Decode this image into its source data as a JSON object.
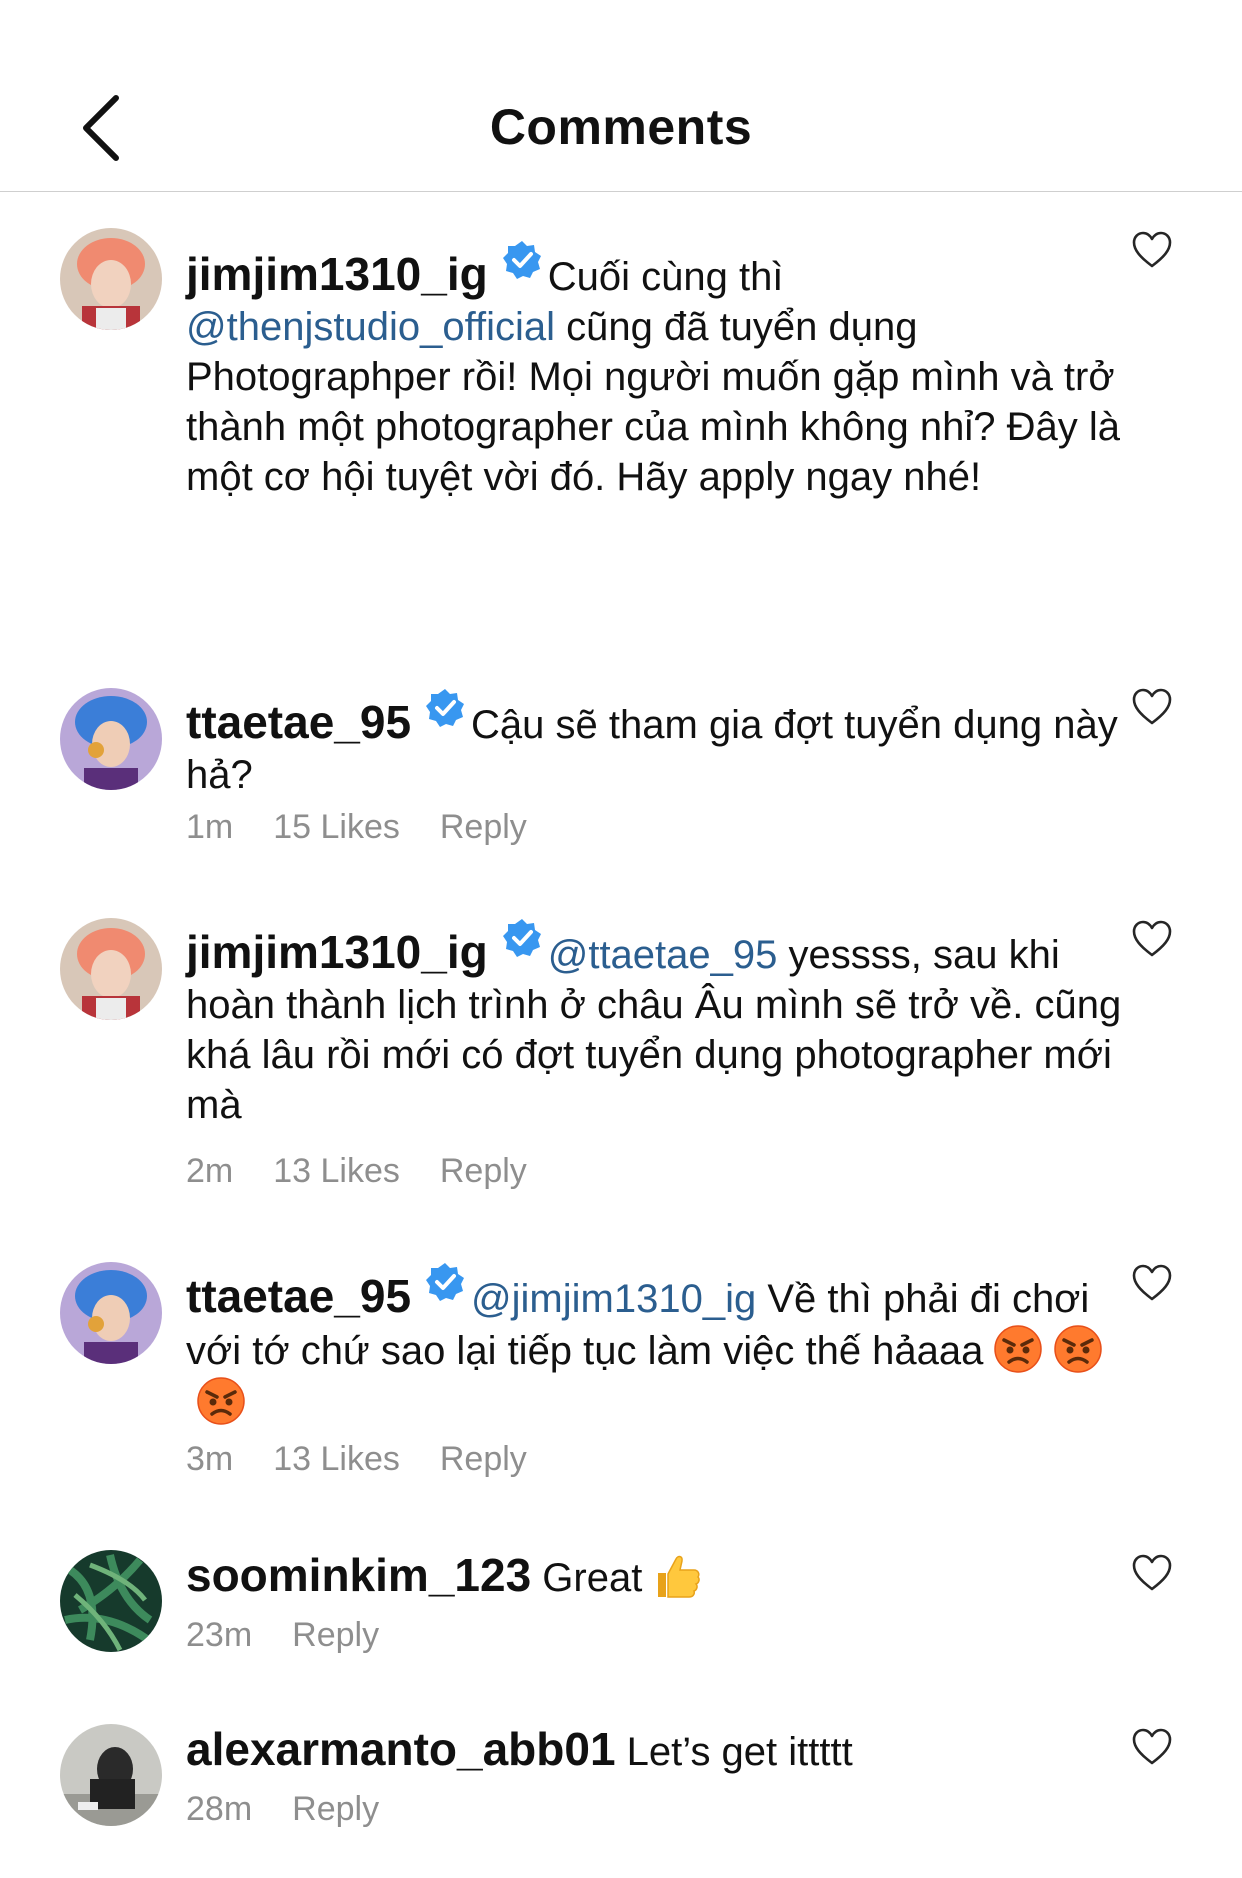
{
  "header": {
    "title": "Comments"
  },
  "comments": [
    {
      "username": "jimjim1310_ig",
      "text_before": "Cuối cùng thì",
      "mention": "@thenjstudio_official",
      "text_after": "cũng đã tuyển dụng Photographper rồi! Mọi người muốn gặp mình và trở thành một photographer của mình không nhỉ? Đây là một cơ hội tuyệt vời đó. Hãy apply ngay nhé!"
    },
    {
      "username": "ttaetae_95",
      "text": "Cậu sẽ tham gia đợt tuyển dụng này hả?",
      "time": "1m",
      "likes": "15 Likes",
      "reply": "Reply"
    },
    {
      "username": "jimjim1310_ig",
      "mention": "@ttaetae_95",
      "text": "yessss, sau khi hoàn thành lịch trình ở châu Âu mình sẽ trở về. cũng khá lâu rồi mới có đợt tuyển dụng photographer mới mà",
      "time": "2m",
      "likes": "13 Likes",
      "reply": "Reply"
    },
    {
      "username": "ttaetae_95",
      "mention": "@jimjim1310_ig",
      "text": "Về thì phải đi chơi với tớ chứ sao lại tiếp tục làm việc thế hảaaa",
      "time": "3m",
      "likes": "13 Likes",
      "reply": "Reply"
    },
    {
      "username": "soominkim_123",
      "text": "Great",
      "time": "23m",
      "reply": "Reply"
    },
    {
      "username": "alexarmanto_abb01",
      "text": "Let’s get ittttt",
      "time": "28m",
      "reply": "Reply"
    }
  ],
  "icons": {
    "back": "chevron-left-icon",
    "verified": "verified-badge-icon",
    "like": "heart-outline-icon",
    "angry": "angry-face-emoji",
    "thumbs_up": "thumbs-up-emoji"
  },
  "colors": {
    "mention": "#2b5e8f",
    "meta": "#8e8e8e",
    "verified": "#3897f0"
  }
}
